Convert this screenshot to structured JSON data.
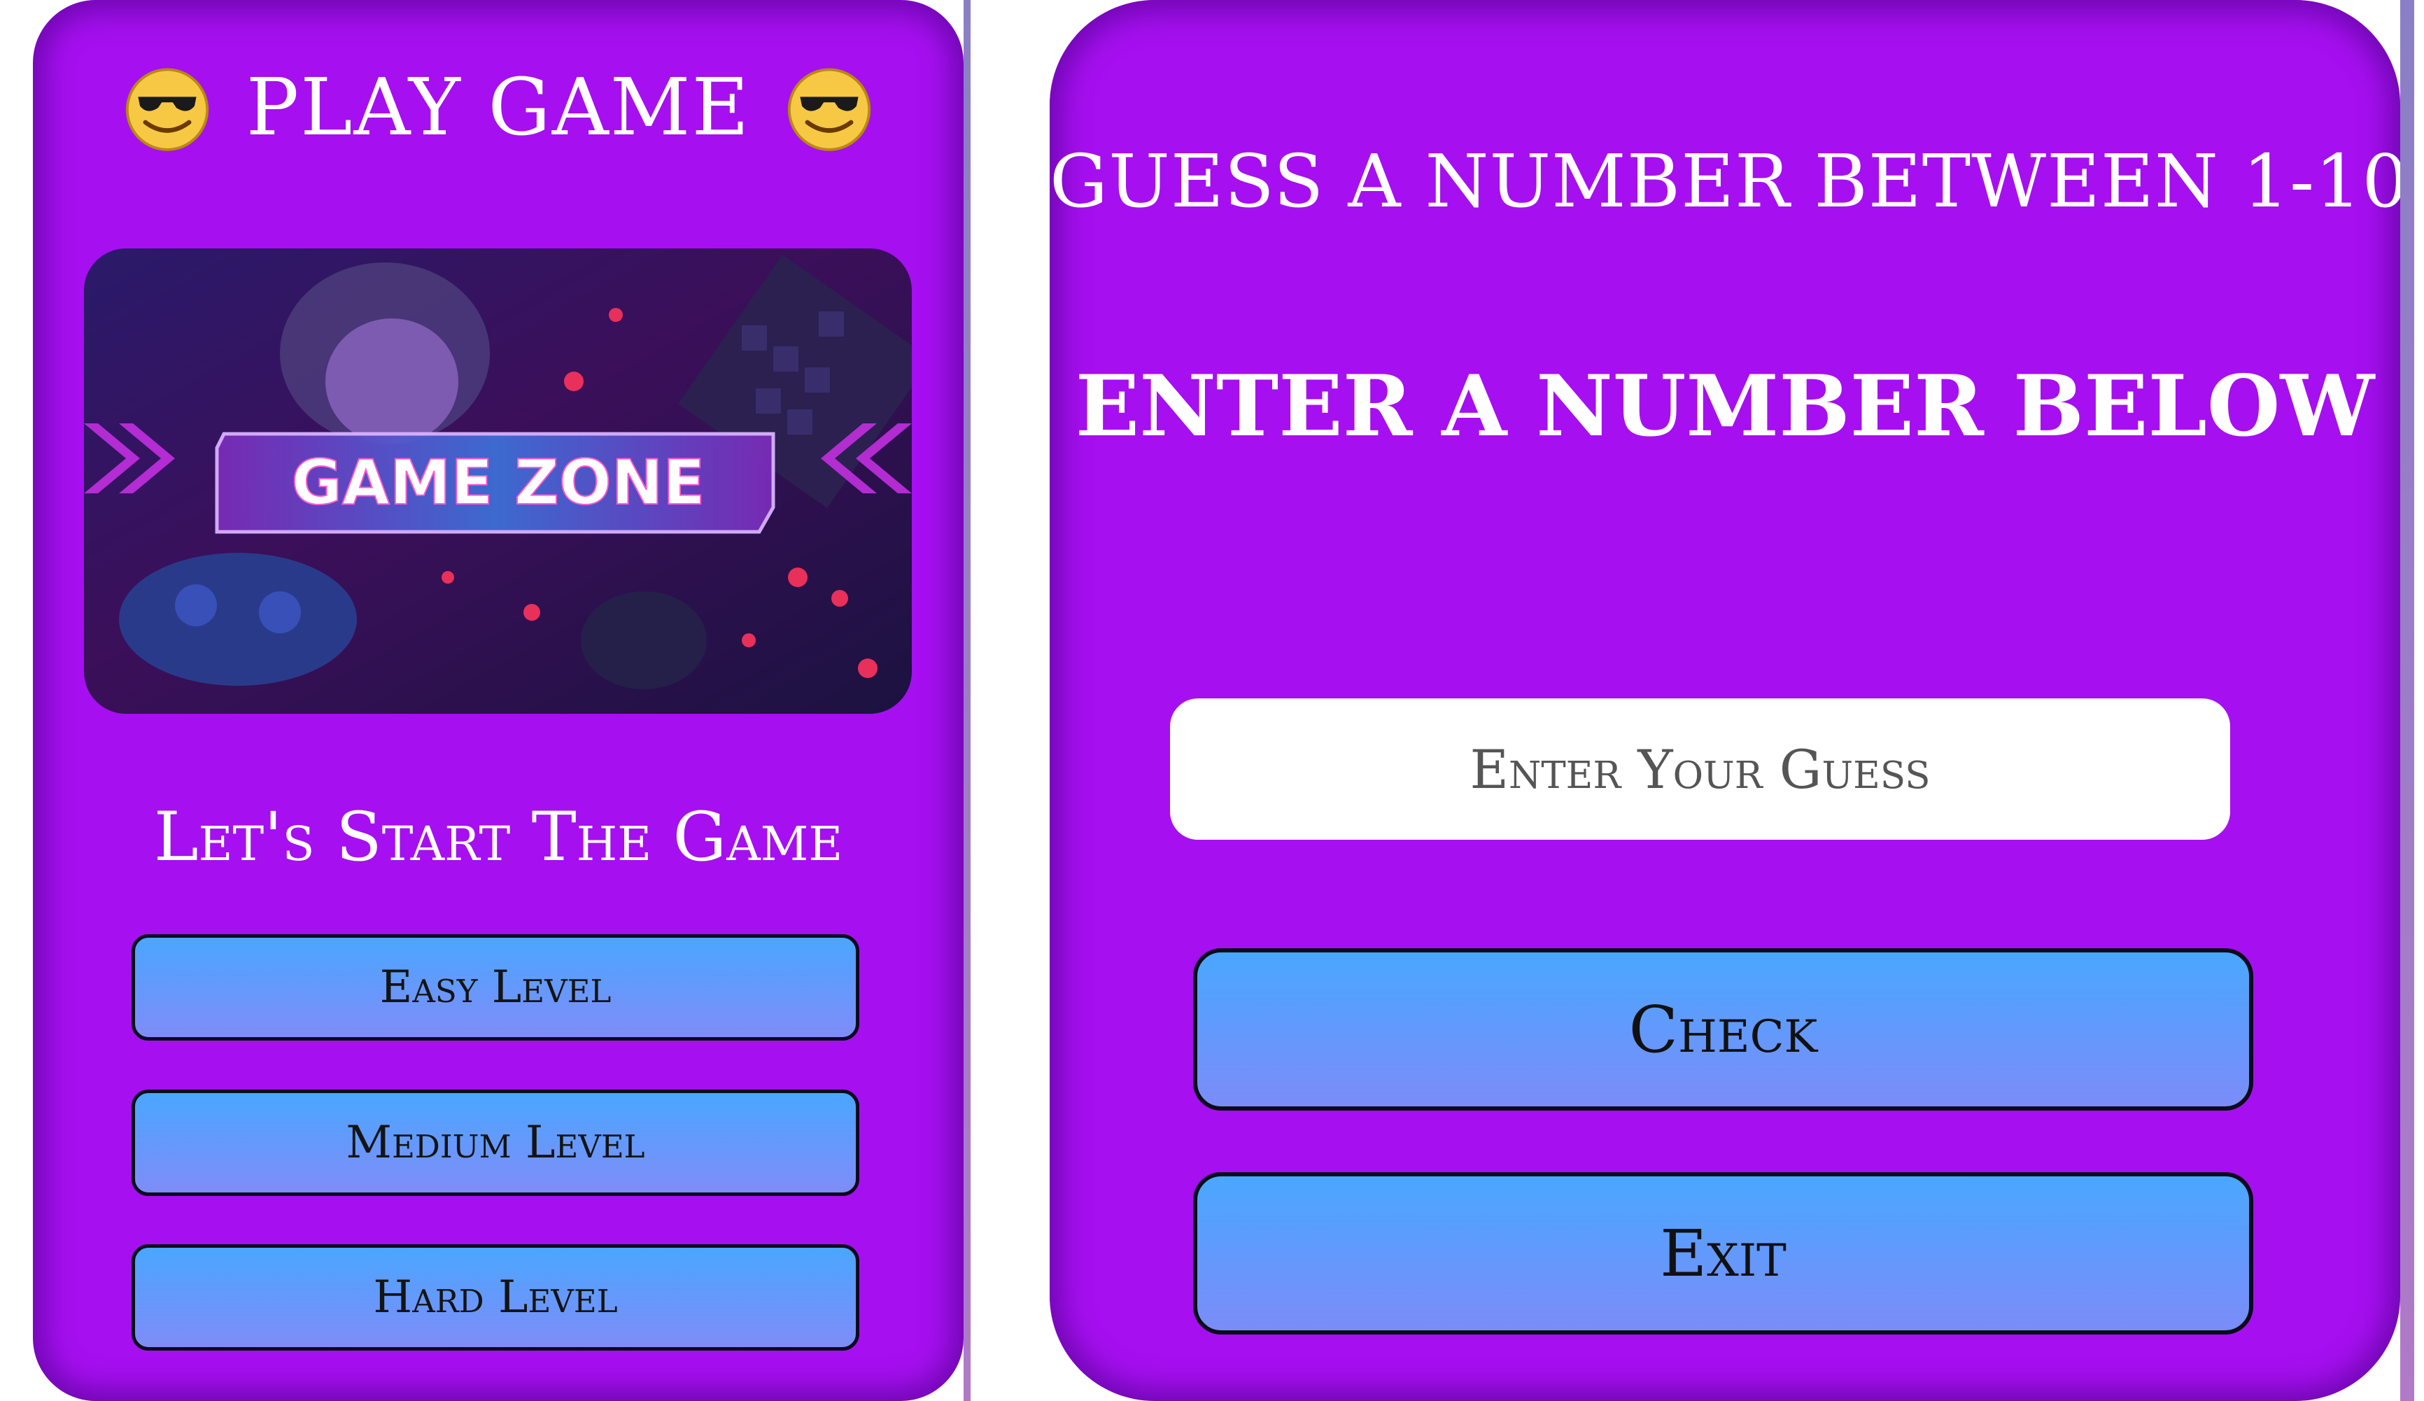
{
  "left_screen": {
    "title": "PLAY GAME",
    "title_icon": "smiling-face-with-sunglasses-icon",
    "banner_text": "GAME ZONE",
    "heading": "Let's Start The Game",
    "buttons": {
      "easy": "Easy Level",
      "medium": "Medium Level",
      "hard": "Hard Level"
    }
  },
  "right_screen": {
    "title": "GUESS A NUMBER BETWEEN 1-10",
    "subtitle": "ENTER A NUMBER BELOW",
    "input": {
      "placeholder": "Enter Your Guess",
      "value": ""
    },
    "buttons": {
      "check": "Check",
      "exit": "Exit"
    }
  },
  "colors": {
    "card_background": "#a60ff0",
    "button_gradient_top": "#4aa6ff",
    "button_gradient_bottom": "#7f8cf8",
    "text_light": "#ffffff"
  }
}
